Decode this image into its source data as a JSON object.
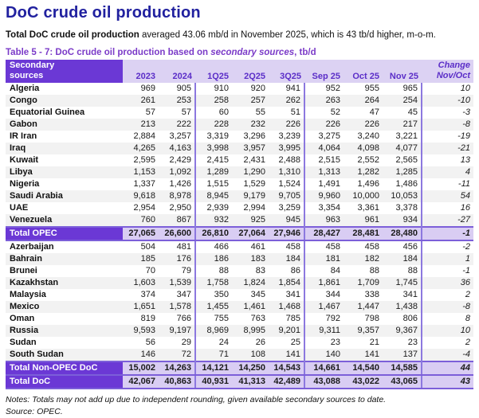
{
  "colors": {
    "title_blue": "#21219F",
    "caption_purple": "#7B3BC8",
    "header_purple": "#6B38D5",
    "header_lavender": "#DCD2F3",
    "header_text_purple": "#5B2EC8",
    "total_lavender": "#D9CDF3",
    "total_border": "#7C5FD9",
    "divider": "#8C78DF",
    "stripe_gray": "#F2F2F2"
  },
  "page": {
    "title": "DoC crude oil production",
    "subtitle_bold": "Total DoC crude oil production",
    "subtitle_rest": " averaged 43.06 mb/d in November 2025, which is 43 tb/d higher, m-o-m.",
    "caption_prefix": "Table 5 - 7: DoC crude oil production based on ",
    "caption_italic": "secondary sources",
    "caption_suffix": ", tb/d",
    "notes": "Notes: Totals may not add up due to independent rounding, given available secondary sources to date.",
    "source": "Source: OPEC."
  },
  "table": {
    "header": {
      "col0_line1": "Secondary",
      "col0_line2": "sources",
      "columns": [
        "2023",
        "2024",
        "1Q25",
        "2Q25",
        "3Q25",
        "Sep 25",
        "Oct 25",
        "Nov 25"
      ],
      "change_line1": "Change",
      "change_line2": "Nov/Oct"
    },
    "rows": [
      {
        "type": "data",
        "name": "Algeria",
        "values": [
          "969",
          "905",
          "910",
          "920",
          "941",
          "952",
          "955",
          "965"
        ],
        "change": "10"
      },
      {
        "type": "data",
        "name": "Congo",
        "values": [
          "261",
          "253",
          "258",
          "257",
          "262",
          "263",
          "264",
          "254"
        ],
        "change": "-10"
      },
      {
        "type": "data",
        "name": "Equatorial Guinea",
        "values": [
          "57",
          "57",
          "60",
          "55",
          "51",
          "52",
          "47",
          "45"
        ],
        "change": "-3"
      },
      {
        "type": "data",
        "name": "Gabon",
        "values": [
          "213",
          "222",
          "228",
          "232",
          "226",
          "226",
          "226",
          "217"
        ],
        "change": "-8"
      },
      {
        "type": "data",
        "name": "IR Iran",
        "values": [
          "2,884",
          "3,257",
          "3,319",
          "3,296",
          "3,239",
          "3,275",
          "3,240",
          "3,221"
        ],
        "change": "-19"
      },
      {
        "type": "data",
        "name": "Iraq",
        "values": [
          "4,265",
          "4,163",
          "3,998",
          "3,957",
          "3,995",
          "4,064",
          "4,098",
          "4,077"
        ],
        "change": "-21"
      },
      {
        "type": "data",
        "name": "Kuwait",
        "values": [
          "2,595",
          "2,429",
          "2,415",
          "2,431",
          "2,488",
          "2,515",
          "2,552",
          "2,565"
        ],
        "change": "13"
      },
      {
        "type": "data",
        "name": "Libya",
        "values": [
          "1,153",
          "1,092",
          "1,289",
          "1,290",
          "1,310",
          "1,313",
          "1,282",
          "1,285"
        ],
        "change": "4"
      },
      {
        "type": "data",
        "name": "Nigeria",
        "values": [
          "1,337",
          "1,426",
          "1,515",
          "1,529",
          "1,524",
          "1,491",
          "1,496",
          "1,486"
        ],
        "change": "-11"
      },
      {
        "type": "data",
        "name": "Saudi Arabia",
        "values": [
          "9,618",
          "8,978",
          "8,945",
          "9,179",
          "9,705",
          "9,960",
          "10,000",
          "10,053"
        ],
        "change": "54"
      },
      {
        "type": "data",
        "name": "UAE",
        "values": [
          "2,954",
          "2,950",
          "2,939",
          "2,994",
          "3,259",
          "3,354",
          "3,361",
          "3,378"
        ],
        "change": "16"
      },
      {
        "type": "data",
        "name": "Venezuela",
        "values": [
          "760",
          "867",
          "932",
          "925",
          "945",
          "963",
          "961",
          "934"
        ],
        "change": "-27"
      },
      {
        "type": "total",
        "name": "Total  OPEC",
        "values": [
          "27,065",
          "26,600",
          "26,810",
          "27,064",
          "27,946",
          "28,427",
          "28,481",
          "28,480"
        ],
        "change": "-1"
      },
      {
        "type": "data",
        "name": "Azerbaijan",
        "values": [
          "504",
          "481",
          "466",
          "461",
          "458",
          "458",
          "458",
          "456"
        ],
        "change": "-2"
      },
      {
        "type": "data",
        "name": "Bahrain",
        "values": [
          "185",
          "176",
          "186",
          "183",
          "184",
          "181",
          "182",
          "184"
        ],
        "change": "1"
      },
      {
        "type": "data",
        "name": "Brunei",
        "values": [
          "70",
          "79",
          "88",
          "83",
          "86",
          "84",
          "88",
          "88"
        ],
        "change": "-1"
      },
      {
        "type": "data",
        "name": "Kazakhstan",
        "values": [
          "1,603",
          "1,539",
          "1,758",
          "1,824",
          "1,854",
          "1,861",
          "1,709",
          "1,745"
        ],
        "change": "36"
      },
      {
        "type": "data",
        "name": "Malaysia",
        "values": [
          "374",
          "347",
          "350",
          "345",
          "341",
          "344",
          "338",
          "341"
        ],
        "change": "2"
      },
      {
        "type": "data",
        "name": "Mexico",
        "values": [
          "1,651",
          "1,578",
          "1,455",
          "1,461",
          "1,468",
          "1,467",
          "1,447",
          "1,438"
        ],
        "change": "-8"
      },
      {
        "type": "data",
        "name": "Oman",
        "values": [
          "819",
          "766",
          "755",
          "763",
          "785",
          "792",
          "798",
          "806"
        ],
        "change": "8"
      },
      {
        "type": "data",
        "name": "Russia",
        "values": [
          "9,593",
          "9,197",
          "8,969",
          "8,995",
          "9,201",
          "9,311",
          "9,357",
          "9,367"
        ],
        "change": "10"
      },
      {
        "type": "data",
        "name": "Sudan",
        "values": [
          "56",
          "29",
          "24",
          "26",
          "25",
          "23",
          "21",
          "23"
        ],
        "change": "2"
      },
      {
        "type": "data",
        "name": "South Sudan",
        "values": [
          "146",
          "72",
          "71",
          "108",
          "141",
          "140",
          "141",
          "137"
        ],
        "change": "-4"
      },
      {
        "type": "total",
        "name": "Total Non-OPEC DoC",
        "values": [
          "15,002",
          "14,263",
          "14,121",
          "14,250",
          "14,543",
          "14,661",
          "14,540",
          "14,585"
        ],
        "change": "44"
      },
      {
        "type": "total",
        "name": "Total DoC",
        "values": [
          "42,067",
          "40,863",
          "40,931",
          "41,313",
          "42,489",
          "43,088",
          "43,022",
          "43,065"
        ],
        "change": "43"
      }
    ]
  }
}
